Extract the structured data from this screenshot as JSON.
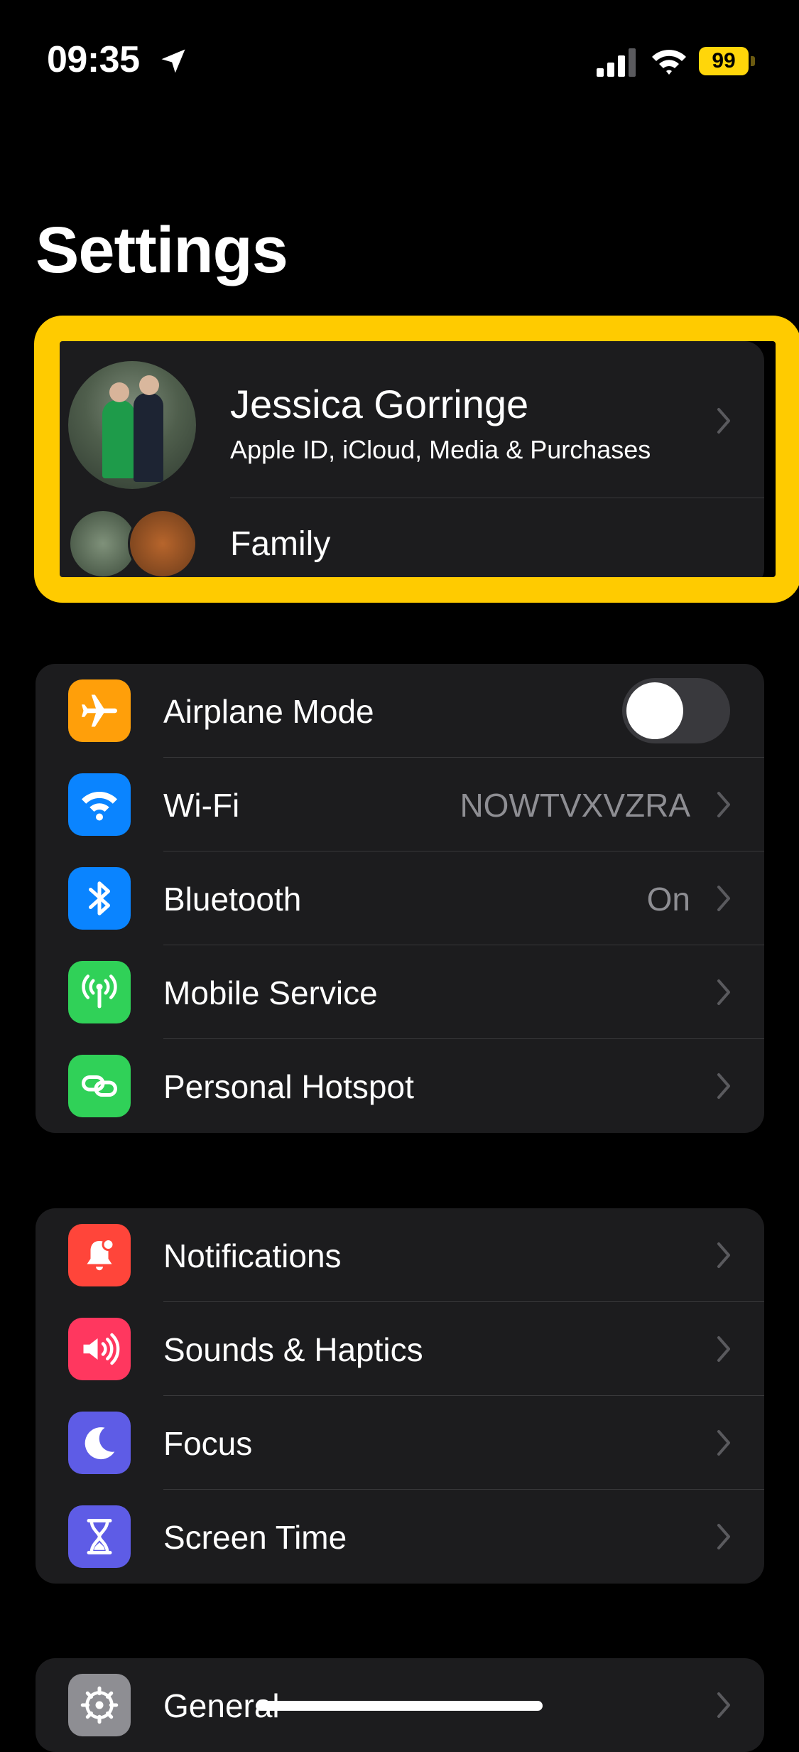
{
  "status_bar": {
    "time": "09:35",
    "battery": "99"
  },
  "page_title": "Settings",
  "profile": {
    "name": "Jessica Gorringe",
    "subtitle": "Apple ID, iCloud, Media & Purchases",
    "family_label": "Family"
  },
  "connectivity": [
    {
      "label": "Airplane Mode",
      "icon": "airplane-icon",
      "color": "#ff9f0a",
      "toggle": false
    },
    {
      "label": "Wi-Fi",
      "icon": "wifi-icon",
      "color": "#0a84ff",
      "value": "NOWTVXVZRA"
    },
    {
      "label": "Bluetooth",
      "icon": "bluetooth-icon",
      "color": "#0a84ff",
      "value": "On"
    },
    {
      "label": "Mobile Service",
      "icon": "antenna-icon",
      "color": "#30d158",
      "value": ""
    },
    {
      "label": "Personal Hotspot",
      "icon": "hotspot-link-icon",
      "color": "#30d158",
      "value": ""
    }
  ],
  "notifications_group": [
    {
      "label": "Notifications",
      "icon": "bell-icon",
      "color": "#ff453a"
    },
    {
      "label": "Sounds & Haptics",
      "icon": "speaker-icon",
      "color": "#ff375f"
    },
    {
      "label": "Focus",
      "icon": "moon-icon",
      "color": "#5e5ce6"
    },
    {
      "label": "Screen Time",
      "icon": "hourglass-icon",
      "color": "#5e5ce6"
    }
  ],
  "general_group": [
    {
      "label": "General",
      "icon": "gear-icon",
      "color": "#8e8e93"
    }
  ]
}
